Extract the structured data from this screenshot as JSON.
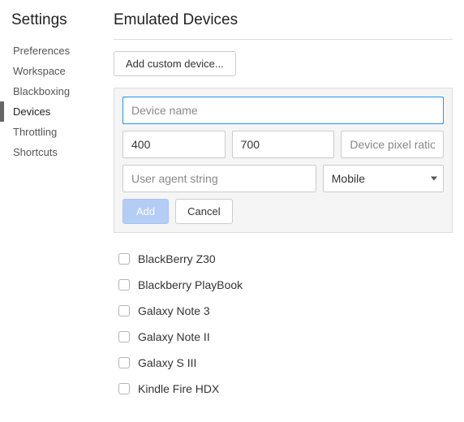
{
  "sidebar": {
    "title": "Settings",
    "items": [
      {
        "label": "Preferences",
        "selected": false
      },
      {
        "label": "Workspace",
        "selected": false
      },
      {
        "label": "Blackboxing",
        "selected": false
      },
      {
        "label": "Devices",
        "selected": true
      },
      {
        "label": "Throttling",
        "selected": false
      },
      {
        "label": "Shortcuts",
        "selected": false
      }
    ]
  },
  "main": {
    "title": "Emulated Devices",
    "add_custom_label": "Add custom device...",
    "form": {
      "name_placeholder": "Device name",
      "name_value": "",
      "width_value": "400",
      "height_value": "700",
      "dpr_placeholder": "Device pixel ratio",
      "dpr_value": "",
      "ua_placeholder": "User agent string",
      "ua_value": "",
      "type_selected": "Mobile",
      "add_label": "Add",
      "cancel_label": "Cancel"
    },
    "devices": [
      {
        "label": "BlackBerry Z30",
        "checked": false
      },
      {
        "label": "Blackberry PlayBook",
        "checked": false
      },
      {
        "label": "Galaxy Note 3",
        "checked": false
      },
      {
        "label": "Galaxy Note II",
        "checked": false
      },
      {
        "label": "Galaxy S III",
        "checked": false
      },
      {
        "label": "Kindle Fire HDX",
        "checked": false
      }
    ]
  }
}
